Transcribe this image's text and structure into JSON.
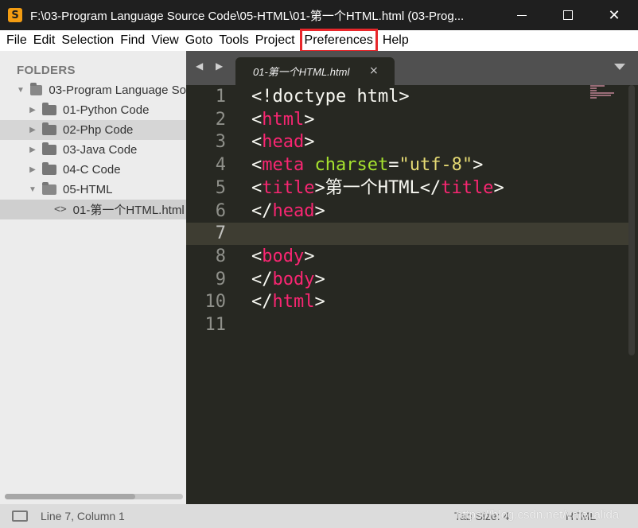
{
  "window": {
    "title": "F:\\03-Program Language Source Code\\05-HTML\\01-第一个HTML.html (03-Prog...",
    "app_icon": "S"
  },
  "menu": [
    "File",
    "Edit",
    "Selection",
    "Find",
    "View",
    "Goto",
    "Tools",
    "Project",
    "Preferences",
    "Help"
  ],
  "sidebar": {
    "header": "FOLDERS",
    "tree": [
      {
        "label": "03-Program Language So",
        "type": "folder-open",
        "arrow": "▼"
      },
      {
        "label": "01-Python Code",
        "type": "folder",
        "arrow": "▶"
      },
      {
        "label": "02-Php Code",
        "type": "folder",
        "arrow": "▶"
      },
      {
        "label": "03-Java Code",
        "type": "folder",
        "arrow": "▶"
      },
      {
        "label": "04-C Code",
        "type": "folder",
        "arrow": "▶"
      },
      {
        "label": "05-HTML",
        "type": "folder-open",
        "arrow": "▼"
      },
      {
        "label": "01-第一个HTML.html",
        "type": "file",
        "arrow": ""
      }
    ]
  },
  "tabs": {
    "nav": "◀ ▶",
    "active_tab": "01-第一个HTML.html",
    "close": "×"
  },
  "editor": {
    "lines": [
      {
        "n": "1",
        "tokens": [
          [
            "txt",
            "<!doctype html>"
          ]
        ]
      },
      {
        "n": "2",
        "tokens": [
          [
            "txt",
            "<"
          ],
          [
            "tag",
            "html"
          ],
          [
            "txt",
            ">"
          ]
        ]
      },
      {
        "n": "3",
        "tokens": [
          [
            "txt",
            "<"
          ],
          [
            "tag",
            "head"
          ],
          [
            "txt",
            ">"
          ]
        ]
      },
      {
        "n": "4",
        "tokens": [
          [
            "txt",
            "<"
          ],
          [
            "tag",
            "meta"
          ],
          [
            "txt",
            " "
          ],
          [
            "attr",
            "charset"
          ],
          [
            "txt",
            "="
          ],
          [
            "str",
            "\"utf-8\""
          ],
          [
            "txt",
            ">"
          ]
        ]
      },
      {
        "n": "5",
        "tokens": [
          [
            "txt",
            "<"
          ],
          [
            "tag",
            "title"
          ],
          [
            "txt",
            ">第一个HTML</"
          ],
          [
            "tag",
            "title"
          ],
          [
            "txt",
            ">"
          ]
        ]
      },
      {
        "n": "6",
        "tokens": [
          [
            "txt",
            "</"
          ],
          [
            "tag",
            "head"
          ],
          [
            "txt",
            ">"
          ]
        ]
      },
      {
        "n": "7",
        "tokens": [],
        "current": true
      },
      {
        "n": "8",
        "tokens": [
          [
            "txt",
            "<"
          ],
          [
            "tag",
            "body"
          ],
          [
            "txt",
            ">"
          ]
        ]
      },
      {
        "n": "9",
        "tokens": [
          [
            "txt",
            "</"
          ],
          [
            "tag",
            "body"
          ],
          [
            "txt",
            ">"
          ]
        ]
      },
      {
        "n": "10",
        "tokens": [
          [
            "txt",
            "</"
          ],
          [
            "tag",
            "html"
          ],
          [
            "txt",
            ">"
          ]
        ]
      },
      {
        "n": "11",
        "tokens": []
      }
    ]
  },
  "status": {
    "position": "Line 7, Column 1",
    "tab_size": "Tab Size: 4",
    "syntax": "HTML",
    "watermark": "https://blog.csdn.net/valecalida"
  },
  "colors": {
    "highlight_box": "#e8272b",
    "tag": "#f92672",
    "attr": "#a6e22e",
    "string": "#e6db74"
  }
}
